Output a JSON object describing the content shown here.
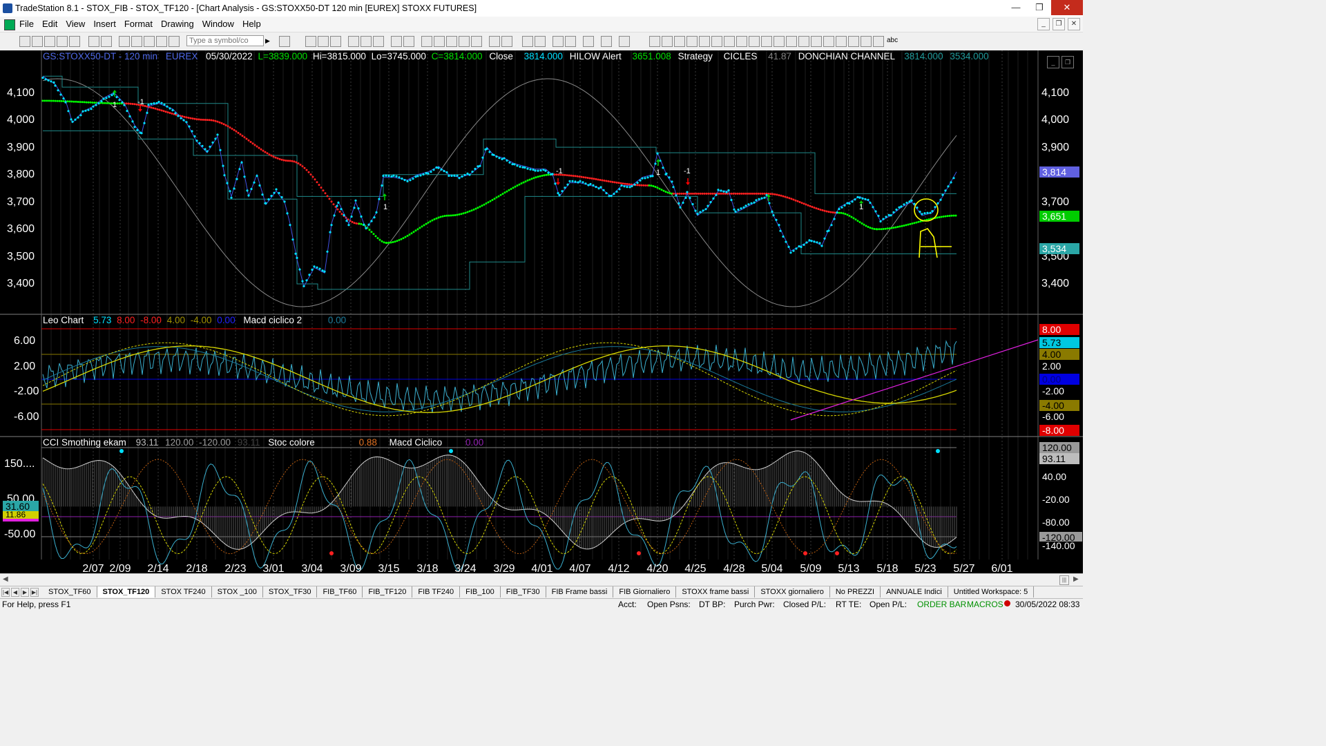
{
  "window": {
    "title": "TradeStation 8.1 - STOX_FIB - STOX_TF120 - [Chart Analysis - GS:STOXX50-DT  120 min  [EUREX] STOXX FUTURES]"
  },
  "menu": [
    "File",
    "Edit",
    "View",
    "Insert",
    "Format",
    "Drawing",
    "Window",
    "Help"
  ],
  "toolbar": {
    "symbol_placeholder": "Type a symbol/co",
    "text_tool": "abc"
  },
  "main_header": {
    "symbol": "GS:STOXX50-DT - 120 min",
    "exchange": "EUREX",
    "date": "05/30/2022",
    "last": "L=3839.000",
    "high": "Hi=3815.000",
    "low": "Lo=3745.000",
    "close_eq": "C=3814.000",
    "close_label": "Close",
    "close_value": "3814.000",
    "hilow_label": "HILOW Alert",
    "hilow_value": "3651.008",
    "strategy": "Strategy",
    "cicles": "CICLES",
    "cicles_value": "41.87",
    "donchian": "DONCHIAN CHANNEL",
    "donchian_v1": "3814.000",
    "donchian_v2": "3534.000"
  },
  "main_axis": [
    "4,100",
    "4,000",
    "3,900",
    "3,800",
    "3,700",
    "3,600",
    "3,500",
    "3,400"
  ],
  "main_badges": [
    {
      "text": "3,814",
      "bg": "#6060e0",
      "fg": "#ffffff"
    },
    {
      "text": "3,651",
      "bg": "#00cc00",
      "fg": "#ffffff"
    },
    {
      "text": "3,534",
      "bg": "#2aa6a6",
      "fg": "#ffffff"
    }
  ],
  "signals": {
    "one": "1",
    "minus_one": "-1"
  },
  "panel2": {
    "name": "Leo Chart",
    "v1": "5.73",
    "v2": "8.00",
    "v3": "-8.00",
    "v4": "4.00",
    "v5": "-4.00",
    "v6": "0.00",
    "macd": "Macd ciclico 2",
    "macd_value": "0.00",
    "axis": [
      "6.00",
      "2.00",
      "-2.00",
      "-6.00"
    ]
  },
  "panel2_badges": [
    {
      "text": "8.00",
      "bg": "#e00000",
      "fg": "#ffffff"
    },
    {
      "text": "5.73",
      "bg": "#00c8e0",
      "fg": "#000000"
    },
    {
      "text": "4.00",
      "bg": "#8a7a00",
      "fg": "#000000"
    },
    {
      "text": "2.00",
      "bg": "#000000",
      "fg": "#ffffff"
    },
    {
      "text": "0.00",
      "bg": "#0000e0",
      "fg": "#000080"
    },
    {
      "text": "-2.00",
      "bg": "#000000",
      "fg": "#ffffff"
    },
    {
      "text": "-4.00",
      "bg": "#8a7a00",
      "fg": "#000000"
    },
    {
      "text": "-6.00",
      "bg": "#000000",
      "fg": "#ffffff"
    },
    {
      "text": "-8.00",
      "bg": "#e00000",
      "fg": "#ffffff"
    }
  ],
  "panel3": {
    "name": "CCI Smothing ekam",
    "v1": "93.11",
    "v2": "120.00",
    "v3": "-120.00",
    "v4": "93.11",
    "stoc": "Stoc colore",
    "stoc_value": "0.88",
    "macd": "Macd Ciclico",
    "macd_value": "0.00",
    "axis": [
      "150....",
      "50.00",
      "-50.00"
    ],
    "left_badge1": "31.60",
    "left_badge2": "11.86"
  },
  "panel3_badges": [
    {
      "text": "120.00",
      "bg": "#9a9a9a",
      "fg": "#000000"
    },
    {
      "text": "93.11",
      "bg": "#bdbdbd",
      "fg": "#000000"
    },
    {
      "text": "40.00",
      "bg": "#000000",
      "fg": "#ffffff"
    },
    {
      "text": "-20.00",
      "bg": "#000000",
      "fg": "#ffffff"
    },
    {
      "text": "-80.00",
      "bg": "#000000",
      "fg": "#ffffff"
    },
    {
      "text": "-120.00",
      "bg": "#9a9a9a",
      "fg": "#000000"
    },
    {
      "text": "-140.00",
      "bg": "#000000",
      "fg": "#ffffff"
    }
  ],
  "dates": [
    "2/07",
    "2/09",
    "2/14",
    "2/18",
    "2/23",
    "3/01",
    "3/04",
    "3/09",
    "3/15",
    "3/18",
    "3/24",
    "3/29",
    "4/01",
    "4/07",
    "4/12",
    "4/20",
    "4/25",
    "4/28",
    "5/04",
    "5/09",
    "5/13",
    "5/18",
    "5/23",
    "5/27",
    "6/01"
  ],
  "tabs": [
    "STOX_TF60",
    "STOX_TF120",
    "STOX TF240",
    "STOX _100",
    "STOX_TF30",
    "FIB_TF60",
    "FIB_TF120",
    "FIB TF240",
    "FIB_100",
    "FIB_TF30",
    "FIB Frame bassi",
    "FIB Giornaliero",
    "STOXX frame bassi",
    "STOXX giornaliero",
    "No PREZZI",
    "ANNUALE Indici",
    "Untitled Workspace: 5"
  ],
  "active_tab": "STOX_TF120",
  "status": {
    "help": "For Help, press F1",
    "acct": "Acct:",
    "open_psns": "Open Psns:",
    "dt_bp": "DT BP:",
    "purch_pwr": "Purch Pwr:",
    "closed_pl": "Closed P/L:",
    "rt_te": "RT TE:",
    "open_pl": "Open P/L:",
    "order_bar": "ORDER BAR",
    "macros": "MACROS",
    "datetime": "30/05/2022 08:33"
  },
  "colors": {
    "up_signal": "#00cc00",
    "down_signal": "#ff0000",
    "price": "#00e0ff",
    "ma_up": "#00ff00",
    "ma_down": "#ff2020",
    "annotation": "#ffff00",
    "trendline": "#e020e0"
  }
}
